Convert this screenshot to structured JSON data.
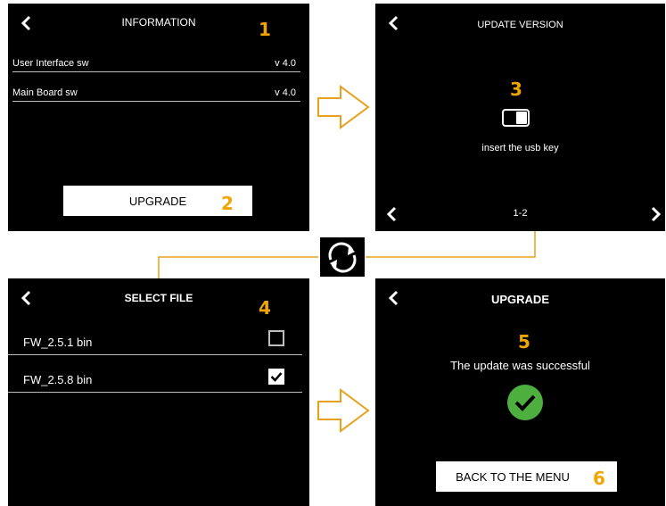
{
  "info_screen": {
    "title": "INFORMATION",
    "step": "1",
    "rows": [
      {
        "label": "User Interface sw",
        "value": "v 4.0"
      },
      {
        "label": "Main Board sw",
        "value": "v 4.0"
      }
    ],
    "button_label": "UPGRADE",
    "button_step": "2"
  },
  "update_screen": {
    "title": "UPDATE VERSION",
    "step": "3",
    "message": "insert the usb key",
    "page_indicator": "1-2"
  },
  "select_screen": {
    "title": "SELECT FILE",
    "step": "4",
    "files": [
      {
        "name": "FW_2.5.1 bin",
        "checked": false
      },
      {
        "name": "FW_2.5.8 bin",
        "checked": true
      }
    ]
  },
  "upgrade_screen": {
    "title": "UPGRADE",
    "step": "5",
    "message": "The update was successful",
    "button_label": "BACK TO THE MENU",
    "button_step": "6"
  },
  "colors": {
    "accent": "#f0a500",
    "success": "#4caf3e",
    "screen_bg": "#000000"
  }
}
